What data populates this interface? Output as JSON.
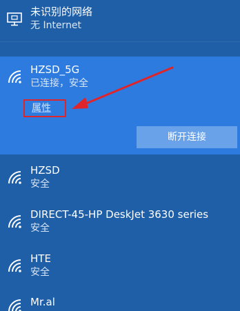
{
  "networks": {
    "wired": {
      "name": "未识别的网络",
      "status": "无 Internet",
      "icon": "monitor-network-icon"
    },
    "connected": {
      "name": "HZSD_5G",
      "status": "已连接，安全",
      "properties_link": "属性",
      "disconnect_label": "断开连接",
      "icon": "wifi-icon"
    },
    "available": [
      {
        "name": "HZSD",
        "status": "安全",
        "icon": "wifi-icon"
      },
      {
        "name": "DIRECT-45-HP DeskJet 3630 series",
        "status": "安全",
        "icon": "wifi-icon"
      },
      {
        "name": "HTE",
        "status": "安全",
        "icon": "wifi-icon"
      },
      {
        "name": "Mr.al",
        "status": "",
        "icon": "wifi-icon"
      }
    ]
  },
  "annotation": {
    "box_color": "#e0252a",
    "arrow_color": "#e0252a"
  },
  "colors": {
    "panel_background": "#1f5fa8",
    "selected_background": "#2e7be0",
    "button_background": "#6aa2ea"
  }
}
